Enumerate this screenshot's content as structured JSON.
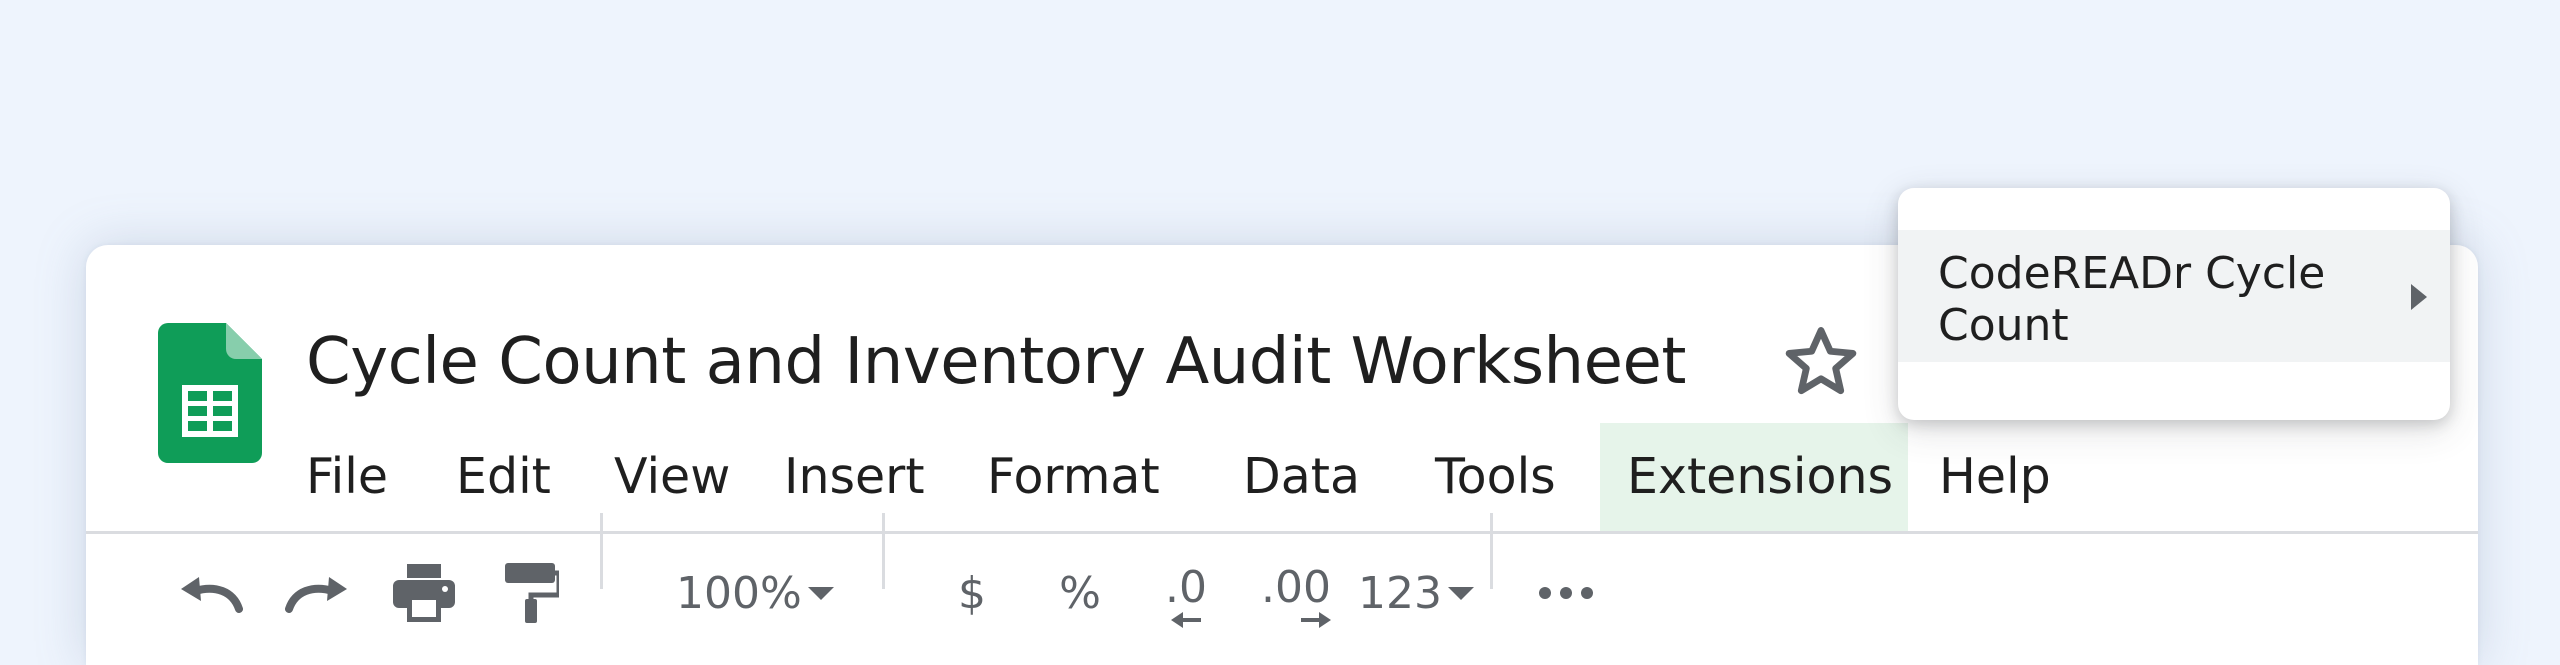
{
  "document": {
    "title": "Cycle Count and Inventory Audit Worksheet"
  },
  "menu": {
    "items": [
      {
        "label": "File"
      },
      {
        "label": "Edit"
      },
      {
        "label": "View"
      },
      {
        "label": "Insert"
      },
      {
        "label": "Format"
      },
      {
        "label": "Data"
      },
      {
        "label": "Tools"
      },
      {
        "label": "Extensions"
      },
      {
        "label": "Help"
      }
    ],
    "active": "Extensions"
  },
  "toolbar": {
    "zoom": "100%",
    "currency": "$",
    "percent": "%",
    "decrease_decimal": ".0",
    "increase_decimal": ".00",
    "number_format": "123",
    "icons": [
      "undo-icon",
      "redo-icon",
      "print-icon",
      "paint-format-icon",
      "dropdown-caret-icon",
      "more-icon"
    ]
  },
  "extensions_menu": {
    "items": [
      {
        "label": "CodeREADr Cycle Count",
        "has_submenu": true
      }
    ]
  },
  "colors": {
    "background": "#eef4fd",
    "sheets_green": "#0f9d58",
    "active_menu_bg": "#e6f4ea",
    "hover_bg": "#f1f3f4",
    "icon_gray": "#5f6368"
  }
}
